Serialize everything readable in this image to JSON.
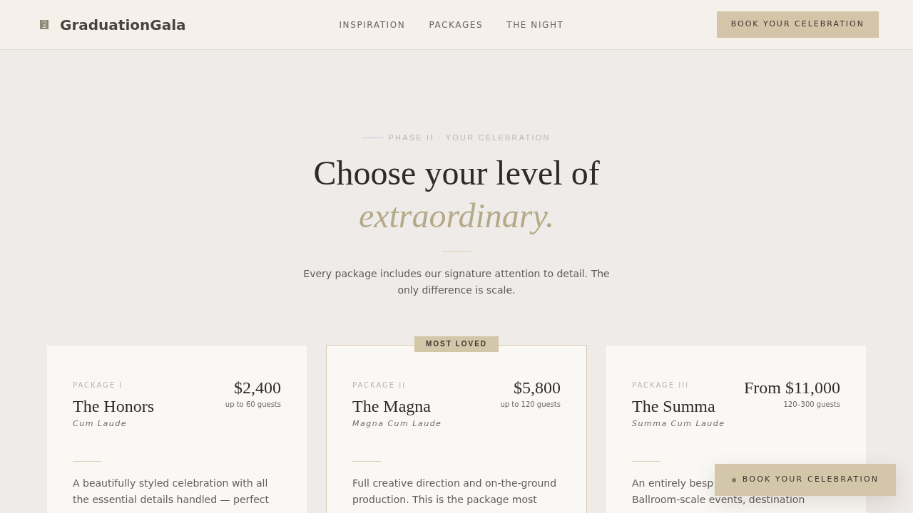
{
  "header": {
    "brand": "GraduationGala",
    "nav": [
      {
        "label": "INSPIRATION"
      },
      {
        "label": "PACKAGES"
      },
      {
        "label": "THE NIGHT"
      }
    ],
    "cta": "BOOK YOUR CELEBRATION"
  },
  "hero": {
    "eyebrow": "PHASE II · YOUR CELEBRATION",
    "title": "Choose your level of",
    "title_accent": "extraordinary.",
    "intro": "Every package includes our signature attention to detail. The only difference is scale."
  },
  "packages": [
    {
      "label": "PACKAGE I",
      "name": "The Honors",
      "honor": "Cum Laude",
      "price": "$2,400",
      "guests": "up to 60 guests",
      "featured": false,
      "description_lines": [
        "A beautifully styled celebration with all",
        "the essential details handled — perfect"
      ]
    },
    {
      "label": "PACKAGE II",
      "name": "The Magna",
      "honor": "Magna Cum Laude",
      "price": "$5,800",
      "guests": "up to 120 guests",
      "featured": true,
      "badge": "MOST LOVED",
      "description_lines": [
        "Full creative direction and on-the-ground",
        "production. This is the package most"
      ]
    },
    {
      "label": "PACKAGE III",
      "name": "The Summa",
      "honor": "Summa Cum Laude",
      "price": "From $11,000",
      "guests": "120–300 guests",
      "featured": false,
      "description_lines": [
        "An entirely besp",
        "Ballroom-scale events, destination"
      ]
    }
  ],
  "floating_button": {
    "label": "BOOK YOUR CELEBRATION"
  }
}
